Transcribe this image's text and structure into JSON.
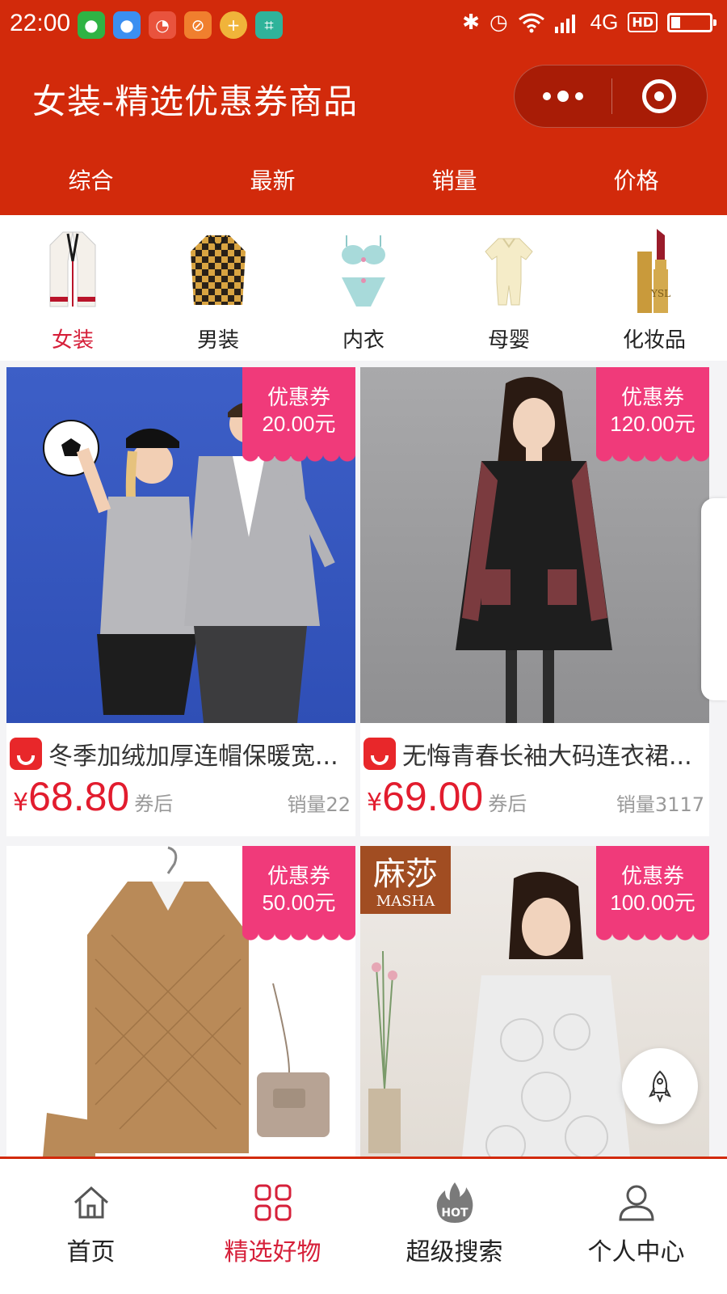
{
  "status_bar": {
    "time": "22:00",
    "network": "4G",
    "hd": "HD",
    "app_icons": [
      "wechat-icon",
      "wechat-icon",
      "notification-icon",
      "ar-icon",
      "add-icon",
      "scan-icon"
    ],
    "battery_level": 0.22
  },
  "navbar": {
    "title": "女装-精选优惠券商品"
  },
  "sort_tabs": [
    "综合",
    "最新",
    "销量",
    "价格"
  ],
  "categories": [
    {
      "label": "女装",
      "icon": "cardigan-icon"
    },
    {
      "label": "男装",
      "icon": "plaid-shirt-icon"
    },
    {
      "label": "内衣",
      "icon": "lingerie-icon"
    },
    {
      "label": "母婴",
      "icon": "baby-romper-icon"
    },
    {
      "label": "化妆品",
      "icon": "lipstick-icon"
    }
  ],
  "products": [
    {
      "title": "冬季加绒加厚连帽保暖宽...",
      "currency": "¥",
      "price": "68.80",
      "price_suffix": "券后",
      "sales": "销量22",
      "coupon_label": "优惠券",
      "coupon_value": "20.00元"
    },
    {
      "title": "无悔青春长袖大码连衣裙...",
      "currency": "¥",
      "price": "69.00",
      "price_suffix": "券后",
      "sales": "销量3117",
      "coupon_label": "优惠券",
      "coupon_value": "120.00元"
    },
    {
      "coupon_label": "优惠券",
      "coupon_value": "50.00元"
    },
    {
      "coupon_label": "优惠券",
      "coupon_value": "100.00元",
      "brand": "麻莎",
      "brand_en": "MASHA"
    }
  ],
  "tabbar": [
    {
      "label": "首页",
      "icon": "home-icon"
    },
    {
      "label": "精选好物",
      "icon": "grid-icon"
    },
    {
      "label": "超级搜索",
      "icon": "hot-icon",
      "badge": "HOT"
    },
    {
      "label": "个人中心",
      "icon": "user-icon"
    }
  ],
  "colors": {
    "primary": "#d22a0b",
    "accent": "#d6203a",
    "coupon": "#f03a7a",
    "price": "#e21c2e"
  }
}
